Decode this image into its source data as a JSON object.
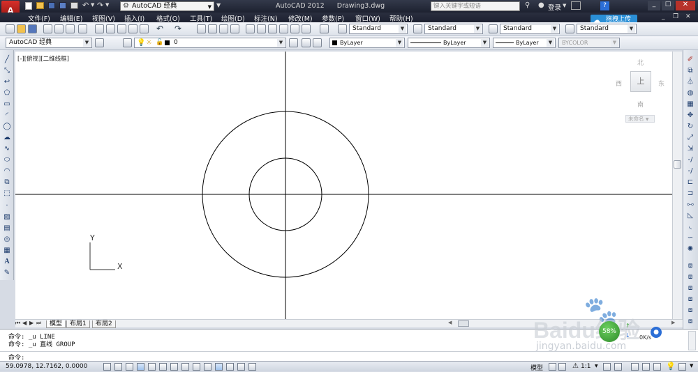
{
  "titlebar": {
    "workspace": "AutoCAD 经典",
    "app_title": "AutoCAD 2012",
    "document": "Drawing3.dwg",
    "search_placeholder": "键入关键字或短语",
    "login": "登录",
    "upload_button": "拖拽上传"
  },
  "menubar": {
    "items": [
      "文件(F)",
      "编辑(E)",
      "视图(V)",
      "插入(I)",
      "格式(O)",
      "工具(T)",
      "绘图(D)",
      "标注(N)",
      "修改(M)",
      "参数(P)",
      "窗口(W)",
      "帮助(H)"
    ]
  },
  "toolbar1": {
    "text_style": "Standard",
    "dim_style": "Standard",
    "table_style": "Standard",
    "mleader_style": "Standard"
  },
  "toolbar2": {
    "workspace_combo": "AutoCAD 经典",
    "layer_value": "0",
    "color": "ByLayer",
    "linetype": "ByLayer",
    "lineweight": "ByLayer",
    "plotstyle": "BYCOLOR"
  },
  "viewport": {
    "label": "[-][俯视][二维线框]",
    "viewcube": {
      "north": "北",
      "south": "南",
      "east": "东",
      "west": "西",
      "top": "上",
      "wcs": "未命名"
    },
    "ucs": {
      "x": "X",
      "y": "Y"
    }
  },
  "layout_tabs": [
    "模型",
    "布局1",
    "布局2"
  ],
  "command": {
    "history": [
      "命令: _u LINE",
      "命令: _u 直线 GROUP"
    ],
    "prompt": "命令:"
  },
  "status": {
    "coords": "59.0978,  12.7162, 0.0000",
    "space": "模型",
    "scale": "1:1",
    "net_badge": "58%",
    "net_speed": "0K/s"
  },
  "watermark": {
    "brand": "Baidu经验",
    "url": "jingyan.baidu.com"
  },
  "colors": {
    "title_bg": "#1d2130",
    "toolbar_bg": "#dde2ea",
    "canvas_bg": "#ffffff",
    "upload_blue": "#2b8fd6",
    "net_green": "#3aa535"
  }
}
